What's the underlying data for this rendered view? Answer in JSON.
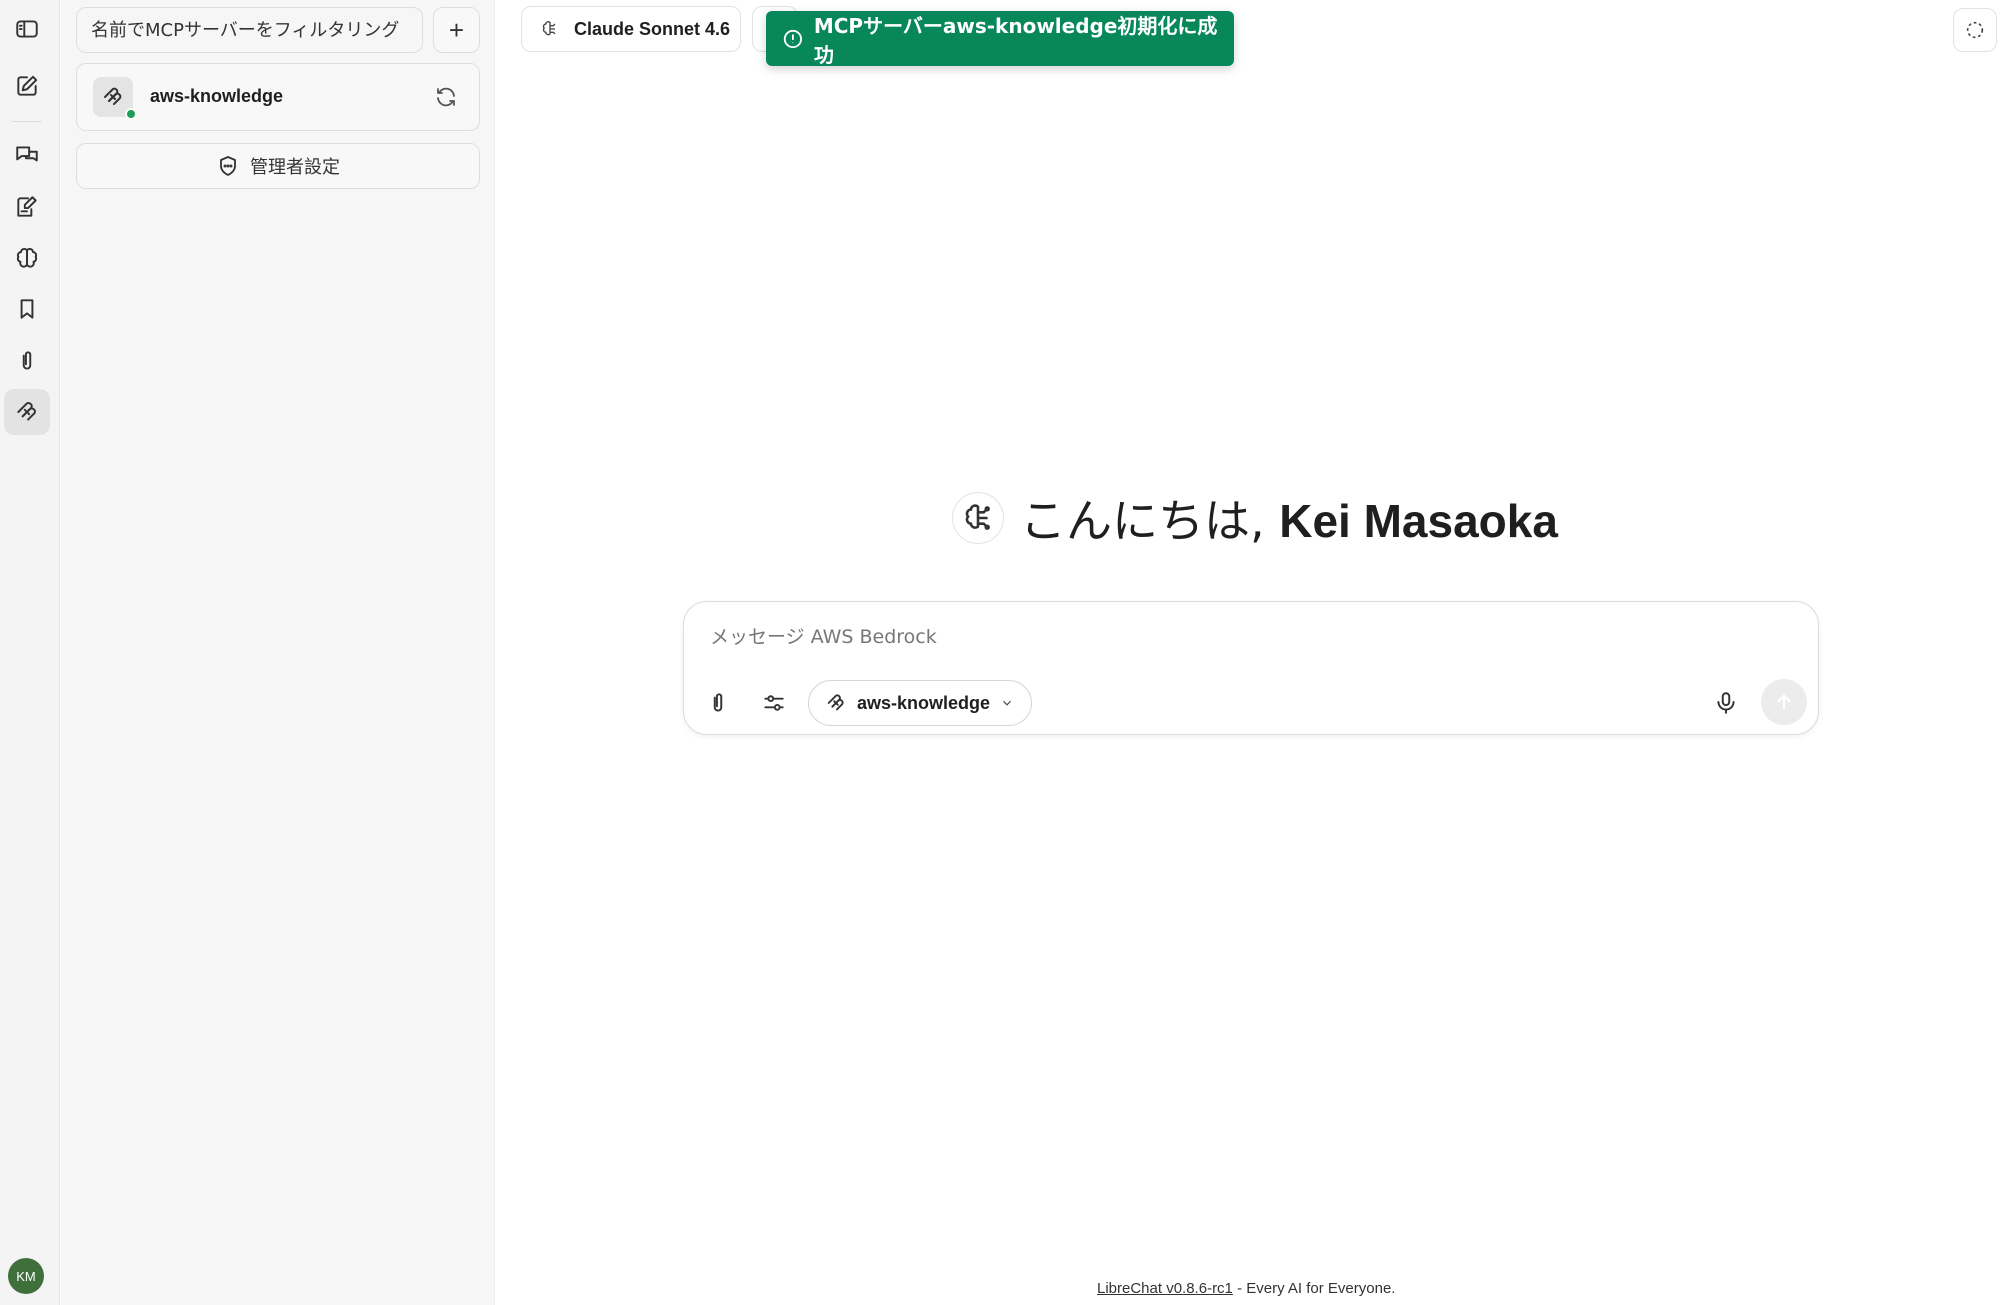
{
  "rail": {
    "items": [
      {
        "name": "sidebar-toggle-icon"
      },
      {
        "name": "new-chat-icon"
      },
      {
        "name": "conversations-icon"
      },
      {
        "name": "prompts-icon"
      },
      {
        "name": "memory-icon"
      },
      {
        "name": "bookmark-icon"
      },
      {
        "name": "attachments-icon"
      },
      {
        "name": "mcp-icon"
      }
    ],
    "active": "mcp-icon",
    "avatar_initials": "KM",
    "avatar_color": "#3f6f3a"
  },
  "mcp_panel": {
    "filter_placeholder": "名前でMCPサーバーをフィルタリング",
    "add_label": "+",
    "servers": [
      {
        "name": "aws-knowledge",
        "status": "connected",
        "status_color": "#1f9d58"
      }
    ],
    "admin_settings_label": "管理者設定"
  },
  "header": {
    "model_label": "Claude Sonnet 4.6"
  },
  "toast": {
    "message": "MCPサーバーaws-knowledge初期化に成功",
    "color": "#07875a"
  },
  "greeting": {
    "prefix": "こんにちは, ",
    "name": "Kei Masaoka"
  },
  "composer": {
    "placeholder": "メッセージ AWS Bedrock",
    "mcp_chip_label": "aws-knowledge"
  },
  "footer": {
    "link_text": "LibreChat v0.8.6-rc1",
    "tagline": " - Every AI for Everyone."
  }
}
